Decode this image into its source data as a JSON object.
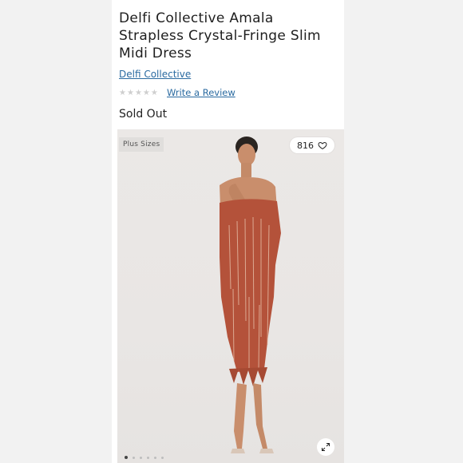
{
  "product": {
    "title": "Delfi Collective Amala Strapless Crystal-Fringe Slim Midi Dress",
    "brand": "Delfi Collective",
    "review_link": "Write a Review",
    "stock_status": "Sold Out",
    "rating": {
      "stars": 0,
      "max": 5,
      "star_icon": "star-icon",
      "star_color": "#cfcfcf"
    }
  },
  "image": {
    "tag": "Plus Sizes",
    "likes": "816",
    "like_icon": "heart-icon",
    "expand_icon": "expand-icon",
    "carousel_total": 6,
    "carousel_current": 1,
    "dress_color": "#b4523a"
  },
  "colors": {
    "link": "#2a6aa0",
    "background": "#f2f2f2"
  }
}
